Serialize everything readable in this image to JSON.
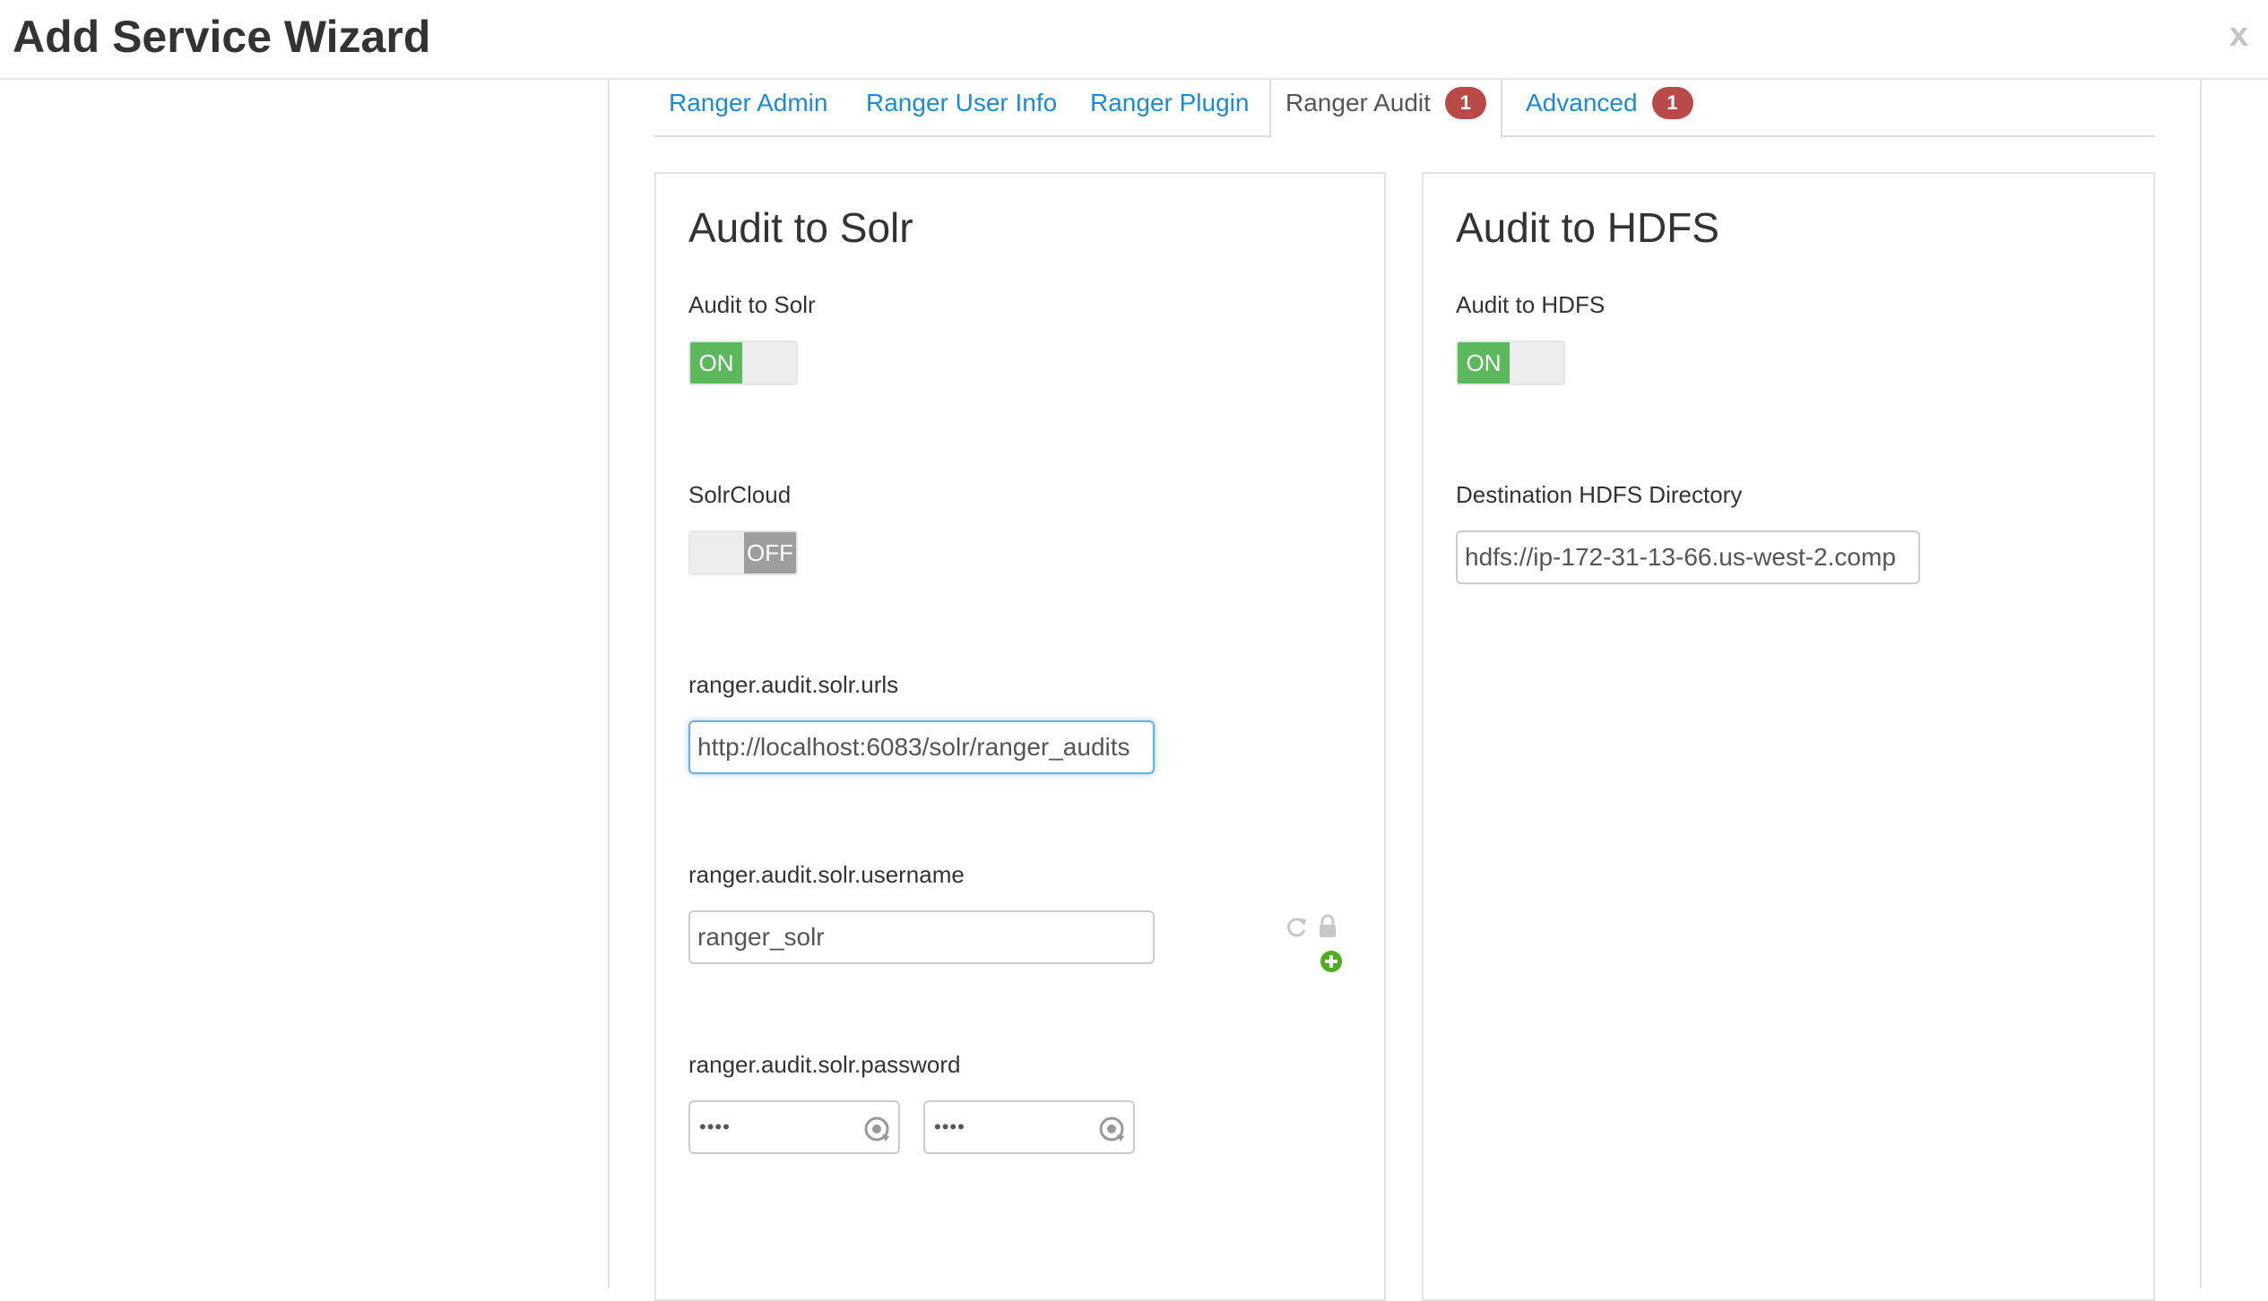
{
  "header": {
    "title": "Add Service Wizard",
    "close_label": "x"
  },
  "tabs": [
    {
      "label": "Ranger Admin"
    },
    {
      "label": "Ranger User Info"
    },
    {
      "label": "Ranger Plugin"
    },
    {
      "label": "Ranger Audit",
      "badge": "1",
      "active": true
    },
    {
      "label": "Advanced",
      "badge": "1"
    }
  ],
  "left_panel": {
    "title": "Audit to Solr",
    "audit_solr": {
      "label": "Audit to Solr",
      "state": "ON"
    },
    "solrcloud": {
      "label": "SolrCloud",
      "state": "OFF"
    },
    "solr_urls": {
      "label": "ranger.audit.solr.urls",
      "value": "http://localhost:6083/solr/ranger_audits"
    },
    "solr_username": {
      "label": "ranger.audit.solr.username",
      "value": "ranger_solr"
    },
    "solr_password": {
      "label": "ranger.audit.solr.password",
      "value": "••••",
      "confirm_value": "••••"
    }
  },
  "right_panel": {
    "title": "Audit to HDFS",
    "audit_hdfs": {
      "label": "Audit to HDFS",
      "state": "ON"
    },
    "hdfs_dir": {
      "label": "Destination HDFS Directory",
      "value": "hdfs://ip-172-31-13-66.us-west-2.comp"
    }
  },
  "colors": {
    "link": "#1a8bd6",
    "badge": "#b94a48",
    "toggle_on": "#5cb85c",
    "toggle_off": "#9e9e9e",
    "add_icon": "#4cae1c"
  },
  "icons": [
    "refresh-icon",
    "lock-icon",
    "plus-circle-icon",
    "eye-icon"
  ]
}
